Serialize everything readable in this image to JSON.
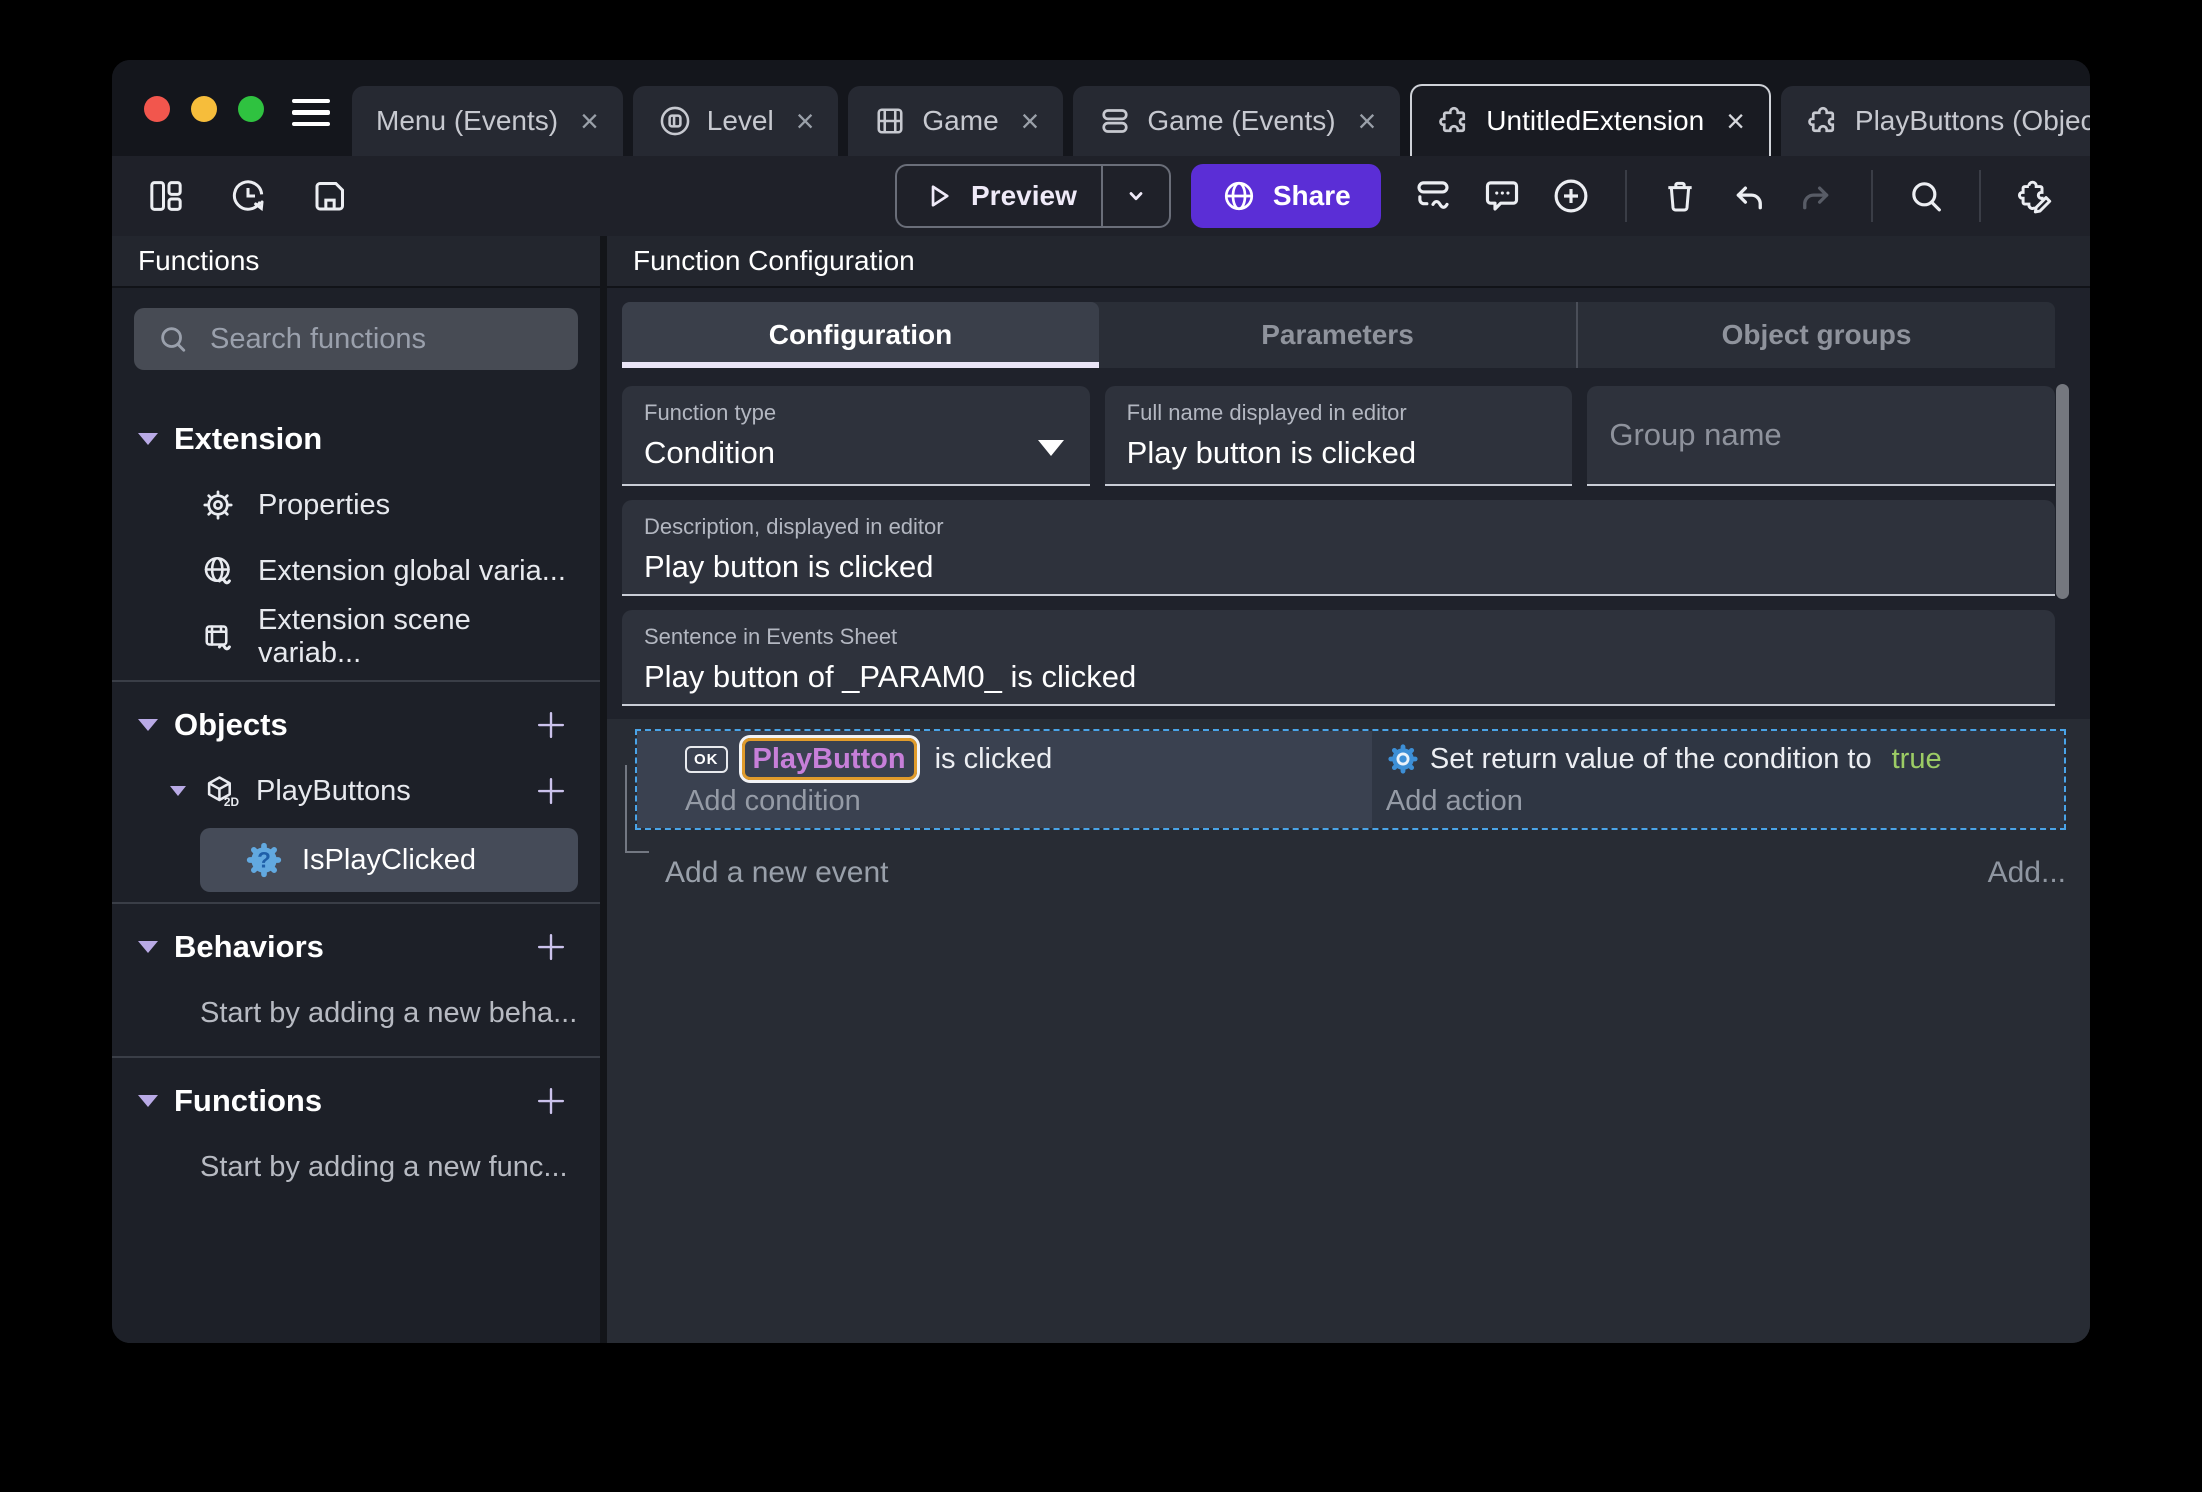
{
  "colors": {
    "accent_purple": "#5b2ed6",
    "selection_blue": "#4aa4e8",
    "object_chip_text": "#c77fd9",
    "object_chip_border": "#e09b2c",
    "true_green": "#9ccc65"
  },
  "titlebar": {
    "close_glyph": "×",
    "tabs": [
      {
        "label": "Menu (Events)"
      },
      {
        "label": "Level"
      },
      {
        "label": "Game"
      },
      {
        "label": "Game (Events)"
      },
      {
        "label": "UntitledExtension"
      },
      {
        "label": "PlayButtons (Object)"
      }
    ]
  },
  "toolbar": {
    "preview_label": "Preview",
    "share_label": "Share"
  },
  "sidebar": {
    "title": "Functions",
    "search_placeholder": "Search functions",
    "extension_section": "Extension",
    "extension_items": [
      "Properties",
      "Extension global varia...",
      "Extension scene variab..."
    ],
    "objects_section": "Objects",
    "object_name": "PlayButtons",
    "function_name": "IsPlayClicked",
    "behaviors_section": "Behaviors",
    "behaviors_note": "Start by adding a new beha...",
    "functions_section": "Functions",
    "functions_note": "Start by adding a new func..."
  },
  "main": {
    "title": "Function Configuration",
    "tabs": [
      "Configuration",
      "Parameters",
      "Object groups"
    ],
    "fields": {
      "function_type": {
        "label": "Function type",
        "value": "Condition"
      },
      "full_name": {
        "label": "Full name displayed in editor",
        "value": "Play button is clicked"
      },
      "group_name": {
        "placeholder": "Group name"
      },
      "description": {
        "label": "Description, displayed in editor",
        "value": "Play button is clicked"
      },
      "sentence": {
        "label": "Sentence in Events Sheet",
        "value": "Play button of _PARAM0_ is clicked"
      }
    }
  },
  "events": {
    "ok_label": "OK",
    "condition_object": "PlayButton",
    "condition_text": "is clicked",
    "add_condition": "Add condition",
    "action_text": "Set return value of the condition to",
    "action_value": "true",
    "add_action": "Add action",
    "add_event": "Add a new event",
    "add_more": "Add..."
  }
}
